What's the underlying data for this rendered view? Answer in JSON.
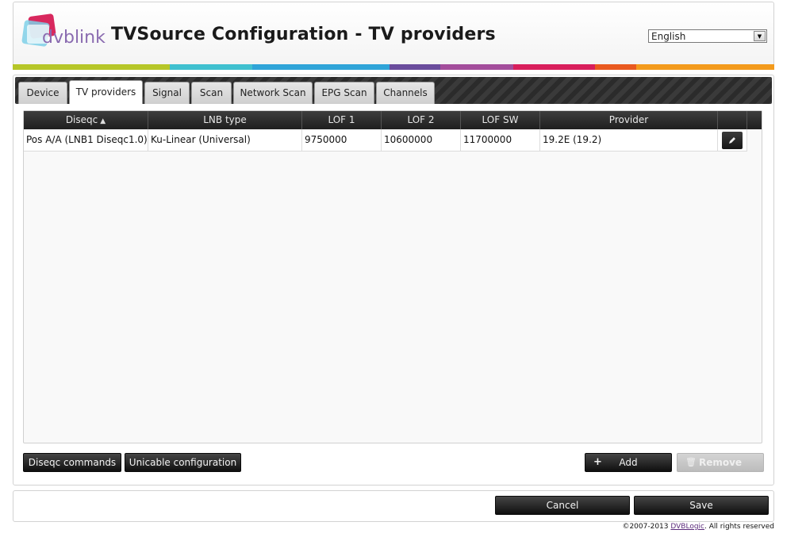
{
  "header": {
    "logo_text": "dvblink",
    "title": "TVSource Configuration - TV providers",
    "language": {
      "selected": "English"
    },
    "colors": [
      "#b6c628",
      "#3fc0cf",
      "#2fa4d8",
      "#6a4c9c",
      "#a34d9b",
      "#d81e5b",
      "#e9591f",
      "#f39a1c"
    ]
  },
  "tabs": [
    {
      "label": "Device",
      "active": false
    },
    {
      "label": "TV providers",
      "active": true
    },
    {
      "label": "Signal",
      "active": false
    },
    {
      "label": "Scan",
      "active": false
    },
    {
      "label": "Network Scan",
      "active": false
    },
    {
      "label": "EPG Scan",
      "active": false
    },
    {
      "label": "Channels",
      "active": false
    }
  ],
  "table": {
    "columns": [
      "Diseqc",
      "LNB type",
      "LOF 1",
      "LOF 2",
      "LOF SW",
      "Provider"
    ],
    "sort_column": "Diseqc",
    "sort_direction": "ascending",
    "rows": [
      {
        "diseqc": "Pos A/A (LNB1 Diseqc1.0)",
        "lnb_type": "Ku-Linear (Universal)",
        "lof1": "9750000",
        "lof2": "10600000",
        "lofsw": "11700000",
        "provider": "19.2E (19.2)"
      }
    ]
  },
  "actions": {
    "diseqc_commands": "Diseqc commands",
    "unicable_configuration": "Unicable configuration",
    "add": "Add",
    "remove": "Remove",
    "remove_enabled": false
  },
  "footer": {
    "cancel": "Cancel",
    "save": "Save",
    "copyright_prefix": "©2007-2013 ",
    "copyright_link": "DVBLogic",
    "copyright_suffix": ". All rights reserved"
  }
}
